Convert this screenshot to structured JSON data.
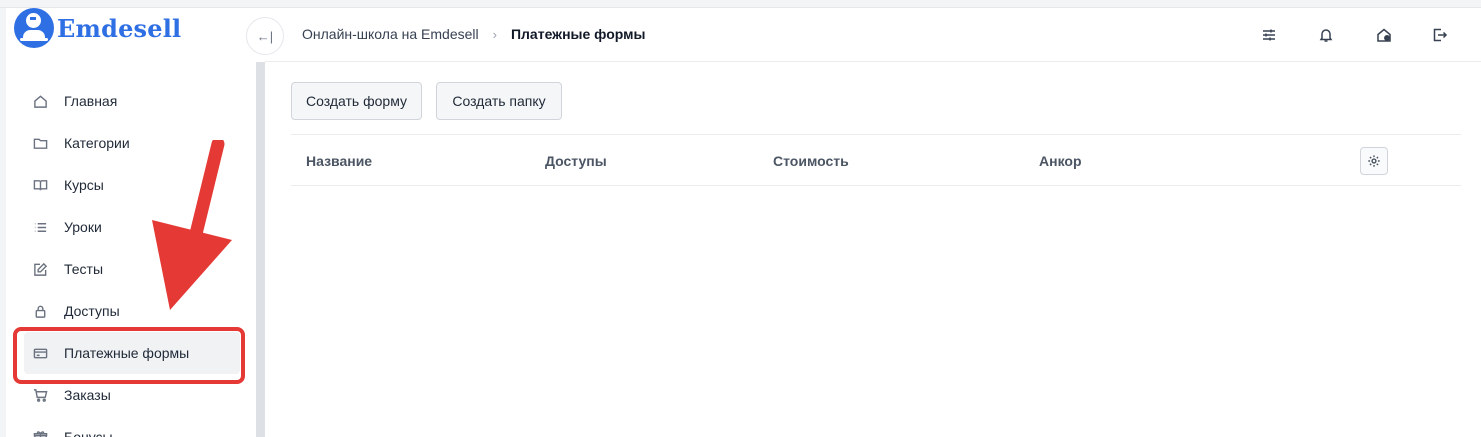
{
  "brand": {
    "name": "Emdesell",
    "color": "#2f6fe4"
  },
  "sidebar": {
    "items": [
      {
        "label": "Главная",
        "icon": "home-icon"
      },
      {
        "label": "Категории",
        "icon": "folder-icon"
      },
      {
        "label": "Курсы",
        "icon": "book-icon"
      },
      {
        "label": "Уроки",
        "icon": "list-icon"
      },
      {
        "label": "Тесты",
        "icon": "edit-icon"
      },
      {
        "label": "Доступы",
        "icon": "lock-icon"
      },
      {
        "label": "Платежные формы",
        "icon": "credit-card-icon",
        "active": true
      },
      {
        "label": "Заказы",
        "icon": "cart-icon"
      },
      {
        "label": "Бонусы",
        "icon": "gift-icon"
      }
    ]
  },
  "header": {
    "breadcrumb": {
      "parent": "Онлайн-школа на Emdesell",
      "current": "Платежные формы"
    },
    "icons": [
      "sliders-icon",
      "bell-icon",
      "home-badge-icon",
      "logout-icon"
    ]
  },
  "toolbar": {
    "create_form": "Создать форму",
    "create_folder": "Создать папку"
  },
  "table": {
    "columns": [
      "Название",
      "Доступы",
      "Стоимость",
      "Анкор"
    ]
  },
  "annotation": {
    "color": "#e53935"
  }
}
